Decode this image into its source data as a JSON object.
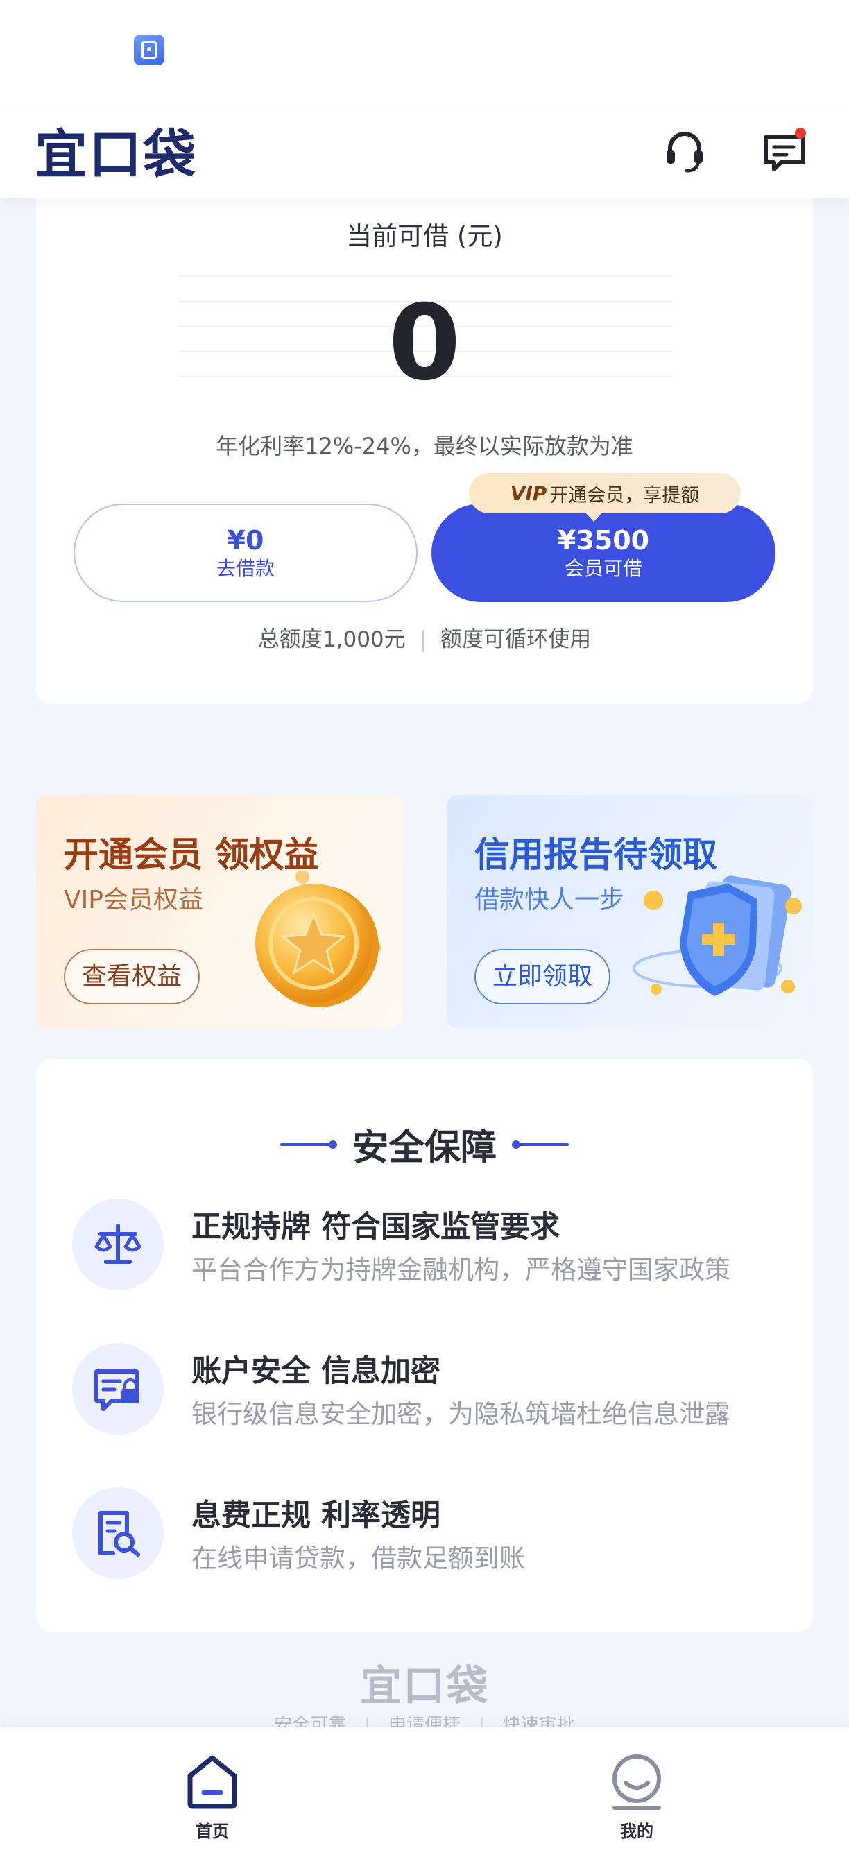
{
  "header": {
    "logo_text": "宜口袋"
  },
  "loan": {
    "label": "当前可借 (元)",
    "amount": "0",
    "rate_note": "年化利率12%-24%，最终以实际放款为准",
    "borrow_button": {
      "amount": "¥0",
      "label": "去借款"
    },
    "vip_button": {
      "amount": "¥3500",
      "label": "会员可借"
    },
    "vip_tip": {
      "badge": "VIP",
      "text": "开通会员，享提额"
    },
    "quota_total": "总额度1,000元",
    "quota_note": "额度可循环使用"
  },
  "promos": [
    {
      "title": "开通会员 领权益",
      "subtitle": "VIP会员权益",
      "button": "查看权益"
    },
    {
      "title": "信用报告待领取",
      "subtitle": "借款快人一步",
      "button": "立即领取"
    }
  ],
  "security": {
    "title": "安全保障",
    "items": [
      {
        "icon": "scale-icon",
        "title": "正规持牌 符合国家监管要求",
        "desc": "平台合作方为持牌金融机构，严格遵守国家政策"
      },
      {
        "icon": "secure-message-icon",
        "title": "账户安全 信息加密",
        "desc": "银行级信息安全加密，为隐私筑墙杜绝信息泄露"
      },
      {
        "icon": "document-search-icon",
        "title": "息费正规  利率透明",
        "desc": "在线申请贷款，借款足额到账"
      }
    ]
  },
  "footer": {
    "logo_text": "宜口袋",
    "slogans": [
      "安全可靠",
      "申请便捷",
      "快速审批"
    ]
  },
  "nav": {
    "home": "首页",
    "mine": "我的"
  },
  "colors": {
    "primary": "#3b4fe0",
    "brand_dark": "#1d2a6b",
    "notification_dot": "#e8392f"
  }
}
